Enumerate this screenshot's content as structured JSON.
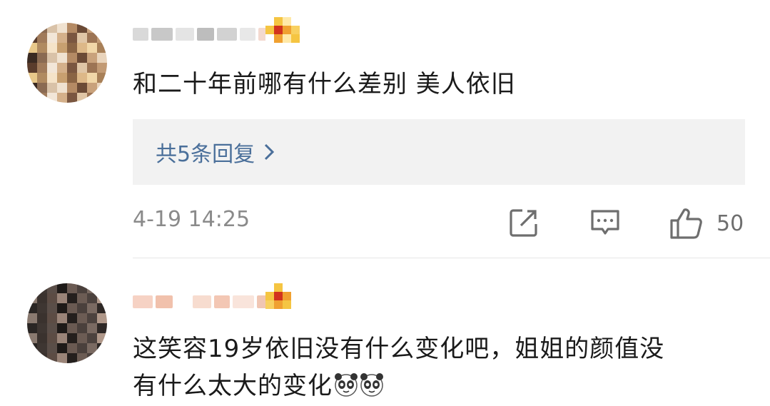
{
  "comments": [
    {
      "username_masked": true,
      "text": "和二十年前哪有什么差别 美人依旧",
      "replies_label": "共5条回复",
      "timestamp": "4-19 14:25",
      "likes": "50"
    },
    {
      "username_masked": true,
      "text_line1": "这笑容19岁依旧没有什么变化吧，姐姐的颜值没",
      "text_line2": "有什么太大的变化",
      "emoji": [
        "panda-face-icon",
        "panda-face-icon"
      ]
    }
  ],
  "colors": {
    "link": "#4a6f9a",
    "meta": "#8a8a8a",
    "reply_bg": "#f2f2f2",
    "text": "#1a1a1a"
  },
  "icons": [
    "share-icon",
    "comment-icon",
    "like-icon",
    "chevron-right-icon"
  ]
}
